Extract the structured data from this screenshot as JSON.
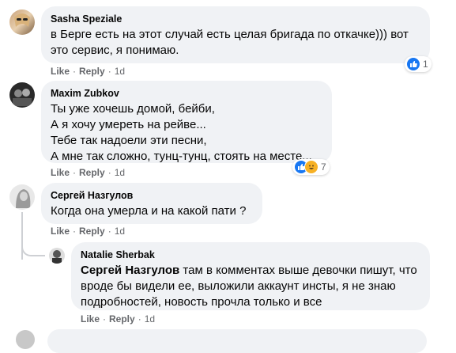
{
  "comments": [
    {
      "author": "Sasha Speziale",
      "text": "в Берге есть на этот случай есть целая бригада по откачке))) вот это сервис, я понимаю.",
      "actions": {
        "like": "Like",
        "reply": "Reply",
        "time": "1d"
      },
      "reactions": {
        "count": "1",
        "icons": [
          "like-icon"
        ]
      }
    },
    {
      "author": "Maxim Zubkov",
      "text": "Ты уже хочешь домой, бейби,\nА я хочу умереть на рейве...\nТебе так надоели эти песни,\nА мне так сложно, тунц-тунц, стоять на месте...",
      "actions": {
        "like": "Like",
        "reply": "Reply",
        "time": "1d"
      },
      "reactions": {
        "count": "7",
        "icons": [
          "like-icon",
          "haha-icon"
        ]
      }
    },
    {
      "author": "Сергей Назгулов",
      "text": "Когда она умерла и на какой пати ?",
      "actions": {
        "like": "Like",
        "reply": "Reply",
        "time": "1d"
      }
    }
  ],
  "reply": {
    "author": "Natalie Sherbak",
    "mention": "Сергей Назгулов",
    "text": " там в комментах выше девочки пишут, что вроде бы видели ее, выложили аккаунт инсты, я не знаю подробностей, новость прочла только и все",
    "actions": {
      "like": "Like",
      "reply": "Reply",
      "time": "1d"
    }
  },
  "colors": {
    "bubble": "#f0f2f5",
    "meta": "#65676b",
    "like_blue": "#1877f2",
    "haha_yellow": "#f7b125"
  }
}
